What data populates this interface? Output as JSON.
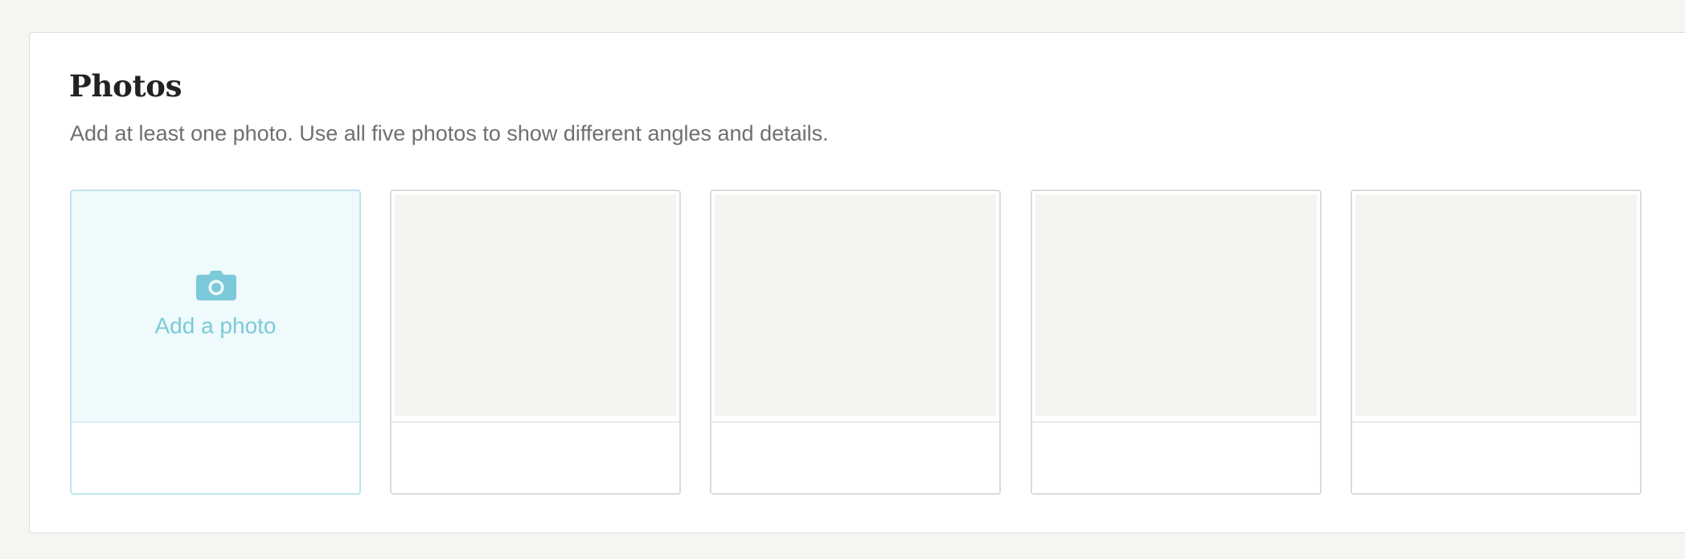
{
  "photos": {
    "title": "Photos",
    "subtitle": "Add at least one photo. Use all five photos to show different angles and details.",
    "add_label": "Add a photo",
    "camera_icon": "camera-icon",
    "accent_color": "#7ccad9",
    "empty_slot_count": 4
  }
}
